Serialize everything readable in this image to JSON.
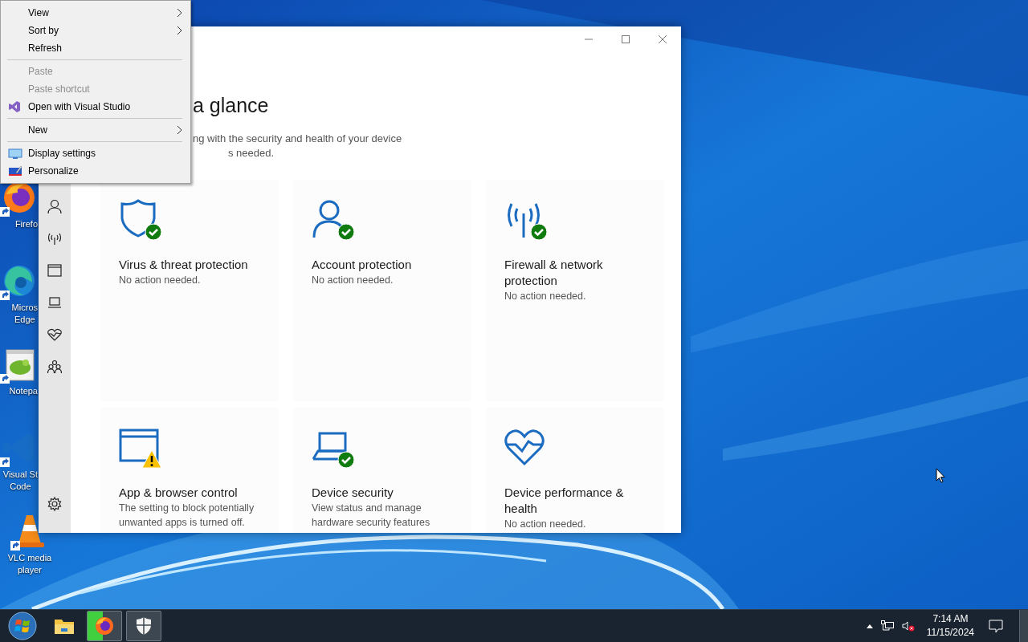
{
  "context_menu": {
    "items": [
      {
        "kind": "plain",
        "label": "View",
        "submenu": true,
        "disabled": false
      },
      {
        "kind": "plain",
        "label": "Sort by",
        "submenu": true,
        "disabled": false
      },
      {
        "kind": "plain",
        "label": "Refresh",
        "submenu": false,
        "disabled": false
      },
      {
        "kind": "separator"
      },
      {
        "kind": "plain",
        "label": "Paste",
        "submenu": false,
        "disabled": true
      },
      {
        "kind": "plain",
        "label": "Paste shortcut",
        "submenu": false,
        "disabled": true
      },
      {
        "kind": "studio",
        "label": "Open with Visual Studio",
        "submenu": false,
        "disabled": false
      },
      {
        "kind": "separator"
      },
      {
        "kind": "plain",
        "label": "New",
        "submenu": true,
        "disabled": false
      },
      {
        "kind": "separator"
      },
      {
        "kind": "display",
        "label": "Display settings",
        "submenu": false,
        "disabled": false
      },
      {
        "kind": "personalize",
        "label": "Personalize",
        "submenu": false,
        "disabled": false
      }
    ]
  },
  "desktop_icons": [
    {
      "kind": "firefox",
      "lines": [
        "Firefo"
      ]
    },
    {
      "kind": "edge",
      "lines": [
        "Micros",
        "Edge"
      ]
    },
    {
      "kind": "notepad",
      "lines": [
        "Notepa"
      ]
    },
    {
      "kind": "vscode",
      "lines": [
        "Visual St",
        "Code"
      ]
    },
    {
      "kind": "vlc",
      "lines": [
        "VLC media",
        "player"
      ]
    }
  ],
  "window": {
    "heading": "a glance",
    "subtitle_lines": [
      "ng with the security and health of your device",
      "s needed."
    ],
    "cards": [
      {
        "kind": "shield",
        "ok": true,
        "warning": false,
        "title": "Virus & threat protection",
        "status": "No action needed."
      },
      {
        "kind": "person",
        "ok": true,
        "warning": false,
        "title": "Account protection",
        "status": "No action needed."
      },
      {
        "kind": "antenna",
        "ok": true,
        "warning": false,
        "title": "Firewall & network protection",
        "status": "No action needed."
      },
      {
        "kind": "browser",
        "ok": false,
        "warning": true,
        "title": "App & browser control",
        "status": "The setting to block potentially unwanted apps is turned off."
      },
      {
        "kind": "laptop",
        "ok": true,
        "warning": false,
        "title": "Device security",
        "status": "View status and manage hardware security features"
      },
      {
        "kind": "heart",
        "ok": false,
        "warning": false,
        "title": "Device performance & health",
        "status": "No action needed."
      }
    ]
  },
  "taskbar": {
    "apps": [
      {
        "kind": "folder",
        "active": false
      },
      {
        "kind": "firefox",
        "active": true,
        "level": 0.45
      },
      {
        "kind": "security",
        "active": true
      }
    ],
    "clock": {
      "time": "7:14 AM",
      "date": "11/15/2024"
    }
  }
}
